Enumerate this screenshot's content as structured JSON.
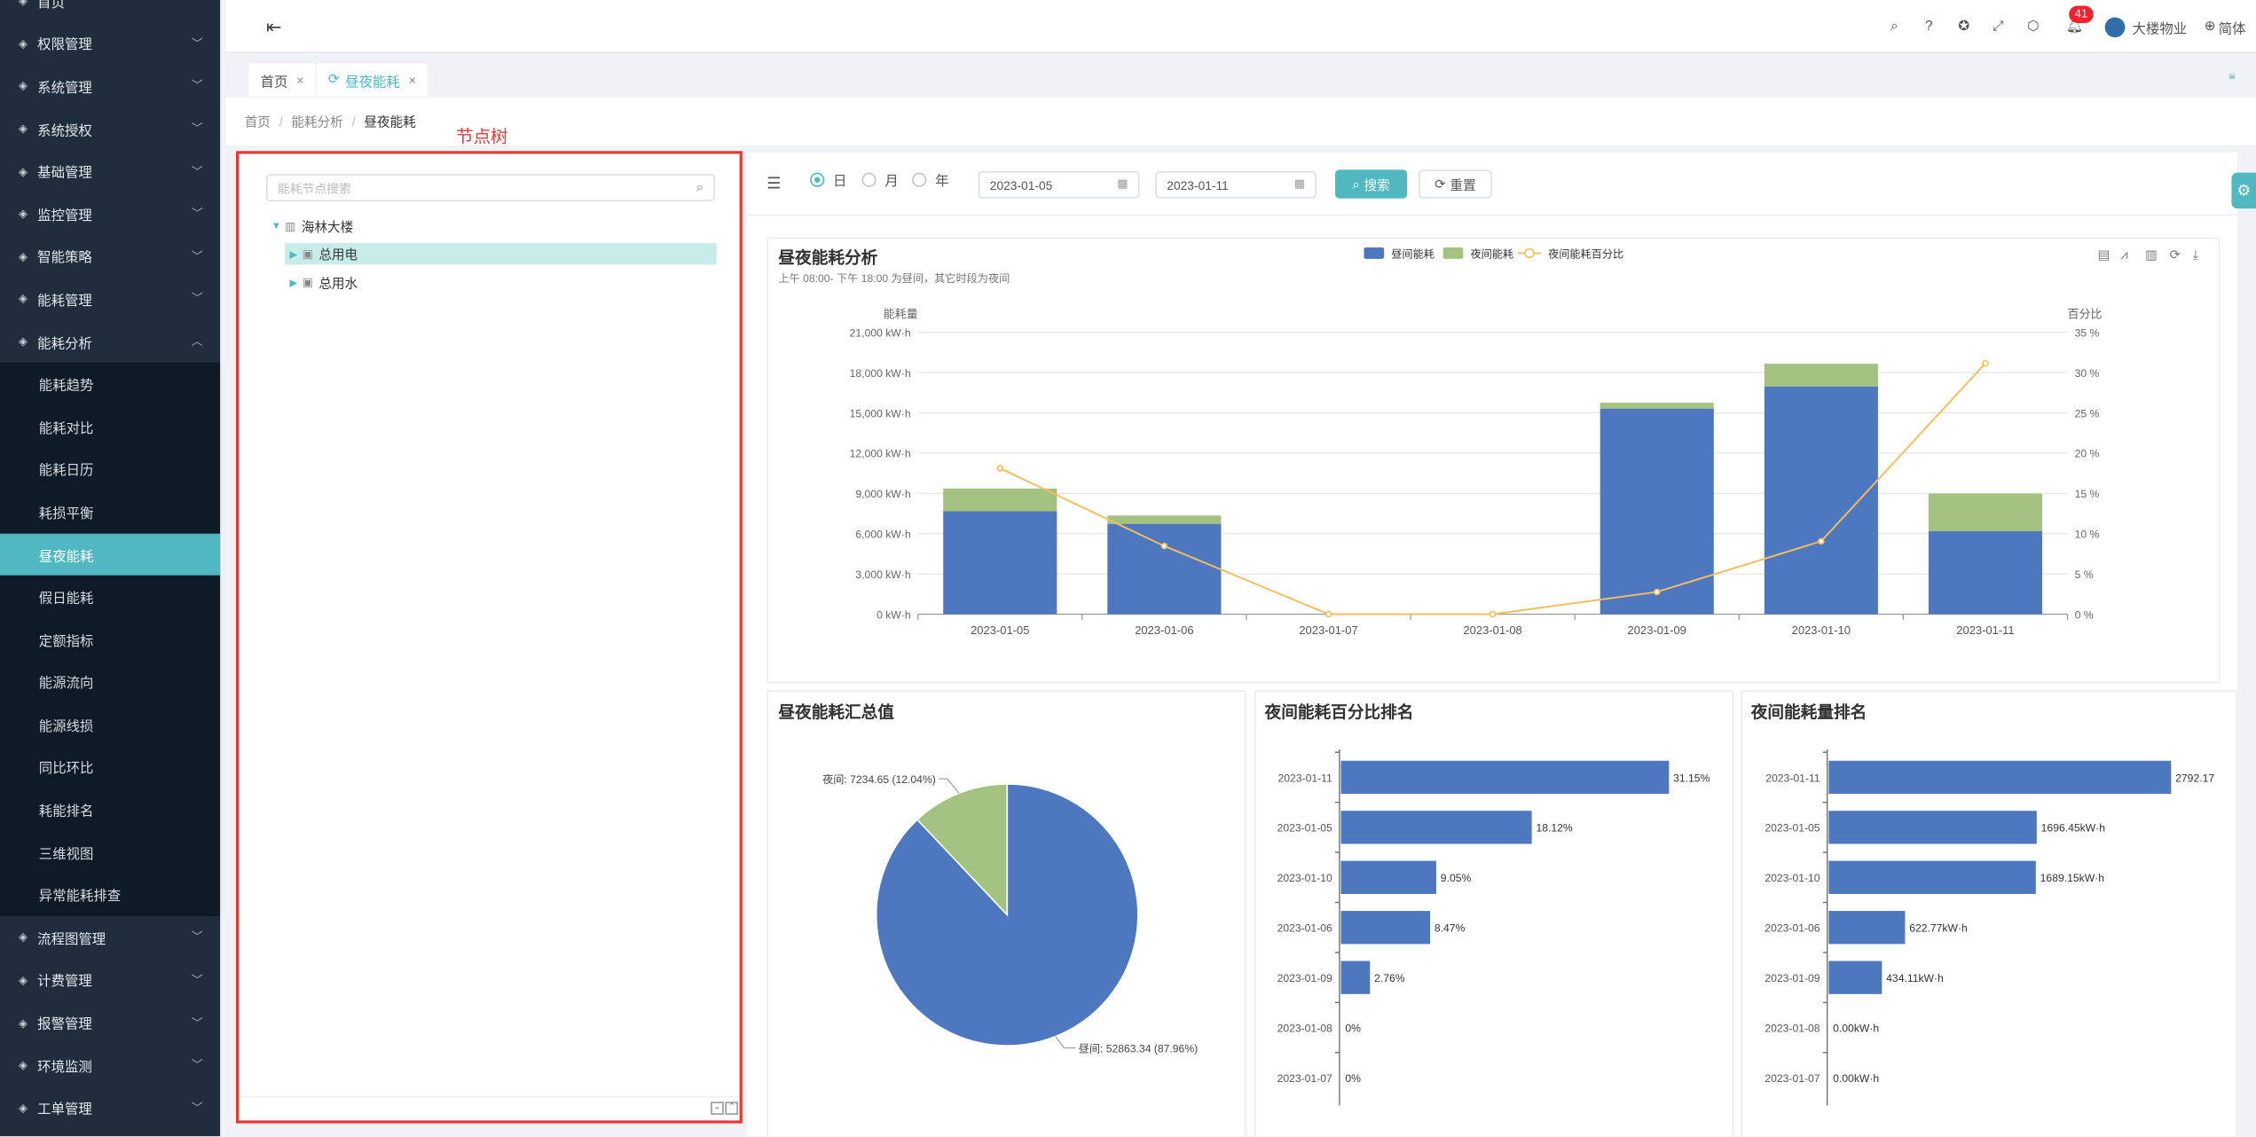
{
  "sidebar": {
    "items": [
      {
        "label": "首页",
        "icon": "home-icon"
      },
      {
        "label": "权限管理",
        "icon": "shield-icon"
      },
      {
        "label": "系统管理",
        "icon": "monitor-icon"
      },
      {
        "label": "系统授权",
        "icon": "key-icon"
      },
      {
        "label": "基础管理",
        "icon": "database-icon"
      },
      {
        "label": "监控管理",
        "icon": "screen-icon"
      },
      {
        "label": "智能策略",
        "icon": "bulb-icon"
      },
      {
        "label": "能耗管理",
        "icon": "sliders-icon"
      },
      {
        "label": "能耗分析",
        "icon": "chart-icon",
        "expanded": true
      }
    ],
    "subitems": [
      {
        "label": "能耗趋势"
      },
      {
        "label": "能耗对比"
      },
      {
        "label": "能耗日历"
      },
      {
        "label": "耗损平衡"
      },
      {
        "label": "昼夜能耗",
        "active": true
      },
      {
        "label": "假日能耗"
      },
      {
        "label": "定额指标"
      },
      {
        "label": "能源流向"
      },
      {
        "label": "能源线损"
      },
      {
        "label": "同比环比"
      },
      {
        "label": "耗能排名"
      },
      {
        "label": "三维视图"
      },
      {
        "label": "异常能耗排查"
      }
    ],
    "items_after": [
      {
        "label": "流程图管理",
        "icon": "flow-icon"
      },
      {
        "label": "计费管理",
        "icon": "wallet-icon"
      },
      {
        "label": "报警管理",
        "icon": "alarm-icon"
      },
      {
        "label": "环境监测",
        "icon": "leaf-icon"
      },
      {
        "label": "工单管理",
        "icon": "layers-icon"
      }
    ]
  },
  "header": {
    "notification_count": "41",
    "user_name": "大楼物业",
    "language": "简体"
  },
  "tabs": [
    {
      "label": "首页",
      "active": false
    },
    {
      "label": "昼夜能耗",
      "active": true
    }
  ],
  "breadcrumb": [
    "首页",
    "能耗分析",
    "昼夜能耗"
  ],
  "annotation_label": "节点树",
  "tree": {
    "search_placeholder": "能耗节点搜索",
    "root": "海林大楼",
    "children": [
      "总用电",
      "总用水"
    ]
  },
  "filter": {
    "radio_day": "日",
    "radio_month": "月",
    "radio_year": "年",
    "start_date": "2023-01-05",
    "end_date": "2023-01-11",
    "search_label": "搜索",
    "reset_label": "重置"
  },
  "colors": {
    "day": "#4d78bf",
    "night": "#a3c17f",
    "line": "#f5bd5c",
    "accent": "#4fb8c1"
  },
  "chart_data": [
    {
      "type": "bar",
      "title": "昼夜能耗分析",
      "subtitle": "上午 08:00- 下午 18:00 为昼间，其它时段为夜间",
      "ylabel": "能耗量",
      "y2label": "百分比",
      "ylim": [
        0,
        21000
      ],
      "y2lim": [
        0,
        35
      ],
      "yticks": [
        "0 kW·h",
        "3,000 kW·h",
        "6,000 kW·h",
        "9,000 kW·h",
        "12,000 kW·h",
        "15,000 kW·h",
        "18,000 kW·h",
        "21,000 kW·h"
      ],
      "y2ticks": [
        "0 %",
        "5 %",
        "10 %",
        "15 %",
        "20 %",
        "25 %",
        "30 %",
        "35 %"
      ],
      "categories": [
        "2023-01-05",
        "2023-01-06",
        "2023-01-07",
        "2023-01-08",
        "2023-01-09",
        "2023-01-10",
        "2023-01-11"
      ],
      "legend": [
        "昼间能耗",
        "夜间能耗",
        "夜间能耗百分比"
      ],
      "series": [
        {
          "name": "昼间能耗",
          "values": [
            7664,
            6727,
            0,
            0,
            15316,
            16966,
            6190
          ]
        },
        {
          "name": "夜间能耗",
          "values": [
            1696.45,
            622.77,
            0,
            0,
            434.11,
            1689.15,
            2792.17
          ]
        },
        {
          "name": "夜间能耗百分比",
          "values": [
            18.12,
            8.47,
            0,
            0,
            2.76,
            9.05,
            31.15
          ]
        }
      ]
    },
    {
      "type": "pie",
      "title": "昼夜能耗汇总值",
      "slices": [
        {
          "label": "昼间: 52863.34 (87.96%)",
          "value": 52863.34
        },
        {
          "label": "夜间: 7234.65 (12.04%)",
          "value": 7234.65
        }
      ]
    },
    {
      "type": "bar",
      "title": "夜间能耗百分比排名",
      "categories": [
        "2023-01-11",
        "2023-01-05",
        "2023-01-10",
        "2023-01-06",
        "2023-01-09",
        "2023-01-08",
        "2023-01-07"
      ],
      "values": [
        31.15,
        18.12,
        9.05,
        8.47,
        2.76,
        0,
        0
      ],
      "labels": [
        "31.15%",
        "18.12%",
        "9.05%",
        "8.47%",
        "2.76%",
        "0%",
        "0%"
      ]
    },
    {
      "type": "bar",
      "title": "夜间能耗量排名",
      "categories": [
        "2023-01-11",
        "2023-01-05",
        "2023-01-10",
        "2023-01-06",
        "2023-01-09",
        "2023-01-08",
        "2023-01-07"
      ],
      "values": [
        2792.17,
        1696.45,
        1689.15,
        622.77,
        434.11,
        0,
        0
      ],
      "labels": [
        "2792.17",
        "1696.45kW·h",
        "1689.15kW·h",
        "622.77kW·h",
        "434.11kW·h",
        "0.00kW·h",
        "0.00kW·h"
      ]
    }
  ]
}
